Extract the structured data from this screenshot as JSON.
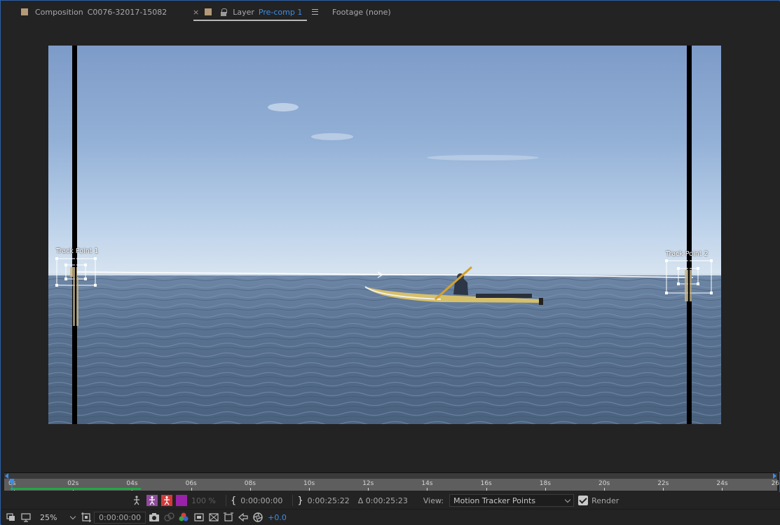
{
  "tabs": {
    "composition": {
      "prefix": "Composition",
      "name": "C0076-32017-15082"
    },
    "layer": {
      "close_glyph": "×",
      "prefix": "Layer",
      "name": "Pre-comp 1"
    },
    "footage": {
      "label": "Footage (none)"
    }
  },
  "viewer": {
    "track_points": [
      {
        "label": "Track Point 1"
      },
      {
        "label": "Track Point 2"
      }
    ]
  },
  "ruler": {
    "ticks": [
      "0s",
      "02s",
      "04s",
      "06s",
      "08s",
      "10s",
      "12s",
      "14s",
      "16s",
      "18s",
      "20s",
      "22s",
      "24s",
      "26"
    ]
  },
  "controls": {
    "opacity": "100 %",
    "in_point": "0:00:00:00",
    "out_point": "0:00:25:22",
    "duration": "Δ 0:00:25:23",
    "view_label": "View:",
    "view_value": "Motion Tracker Points",
    "render_label": "Render",
    "render_checked": true
  },
  "bottom": {
    "zoom": "25%",
    "current_time": "0:00:00:00",
    "exposure": "+0.0"
  },
  "colors": {
    "accent": "#3d8ee6",
    "label_swatch": "#b49a78",
    "work_area": "#21a846"
  }
}
